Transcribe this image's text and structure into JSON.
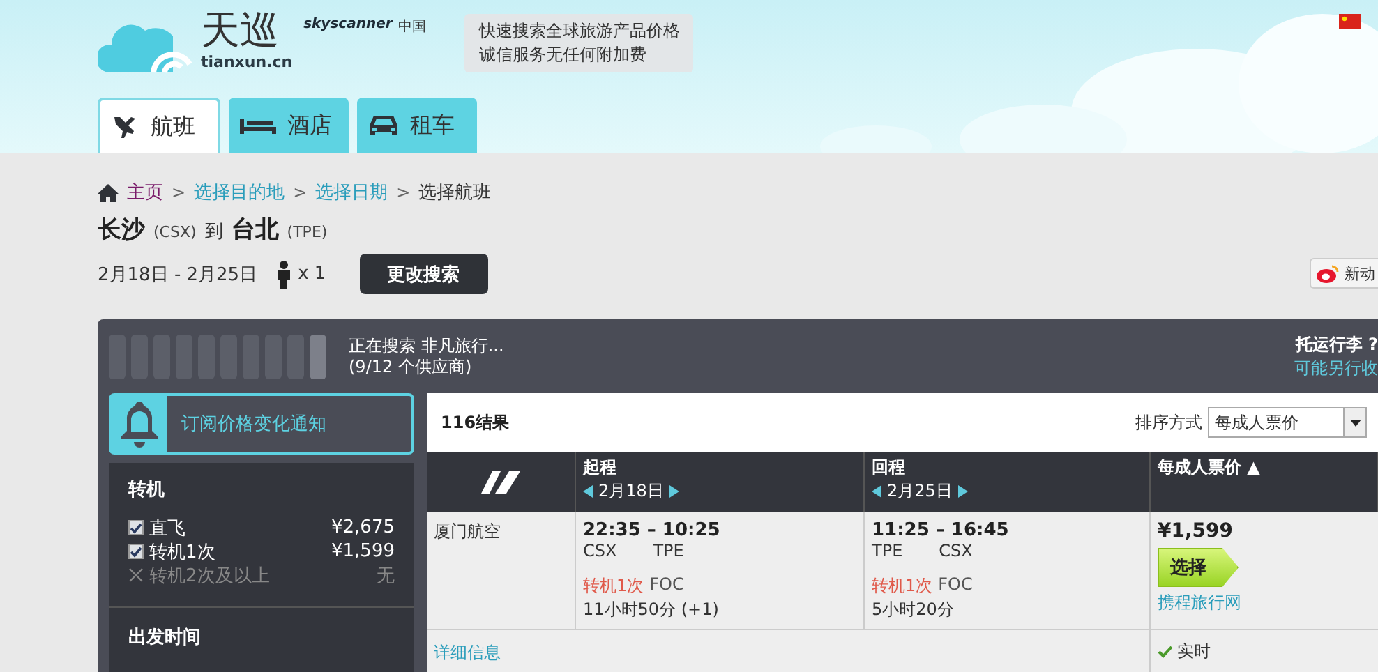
{
  "header": {
    "logo_text": "天巡",
    "logo_domain": "tianxun.cn",
    "brand": "skyscanner",
    "brand_region": "中国",
    "tooltip_lines": [
      "快速搜索全球旅游产品价格",
      "诚信服务无任何附加费"
    ]
  },
  "tabs": [
    {
      "label": "航班",
      "kind": "plane",
      "selected": true
    },
    {
      "label": "酒店",
      "kind": "bed",
      "selected": false
    },
    {
      "label": "租车",
      "kind": "car",
      "selected": false
    }
  ],
  "breadcrumb": [
    {
      "label": "主页",
      "kind": "home"
    },
    {
      "label": "选择目的地",
      "kind": "link"
    },
    {
      "label": "选择日期",
      "kind": "link"
    },
    {
      "label": "选择航班",
      "kind": "current"
    }
  ],
  "breadcrumb_separator": ">",
  "route": {
    "from": "长沙",
    "from_code": "(CSX)",
    "to_word": "到",
    "to": "台北",
    "to_code": "(TPE)"
  },
  "dates": "2月18日 - 2月25日",
  "passengers": "x 1",
  "change_button": "更改搜索",
  "share_button": "新动",
  "search_status": [
    "正在搜索 非凡旅行...",
    "(9/12 个供应商)"
  ],
  "baggage": {
    "title": "托运行李 ?",
    "link": "可能另行收"
  },
  "notify": "订阅价格变化通知",
  "filters": {
    "title": "转机",
    "options": [
      {
        "kind": "checkbox",
        "label": "直飞",
        "price": "¥2,675",
        "checked": true
      },
      {
        "kind": "checkbox",
        "label": "转机1次",
        "price": "¥1,599",
        "checked": true
      },
      {
        "kind": "unavailable",
        "label": "转机2次及以上",
        "price": "无"
      }
    ]
  },
  "filter_next_title": "出发时间",
  "results": {
    "count": "116结果",
    "sort_label": "排序方式",
    "sort_value": "每成人票价"
  },
  "columns": [
    {
      "title": "起程",
      "date": "2月18日"
    },
    {
      "title": "回程",
      "date": "2月25日"
    },
    {
      "title": "每成人票价 ▲"
    }
  ],
  "flight": {
    "airline": "厦门航空",
    "legs": [
      {
        "time": "22:35 – 10:25",
        "from": "CSX",
        "to": "TPE",
        "stops": "转机1次",
        "via": "FOC",
        "duration": "11小时50分 (+1)"
      },
      {
        "time": "11:25 – 16:45",
        "from": "TPE",
        "to": "CSX",
        "stops": "转机1次",
        "via": "FOC",
        "duration": "5小时20分"
      }
    ],
    "price": "¥1,599",
    "select": "选择",
    "agent": "携程旅行网",
    "realtime": "实时",
    "details": "详细信息"
  }
}
